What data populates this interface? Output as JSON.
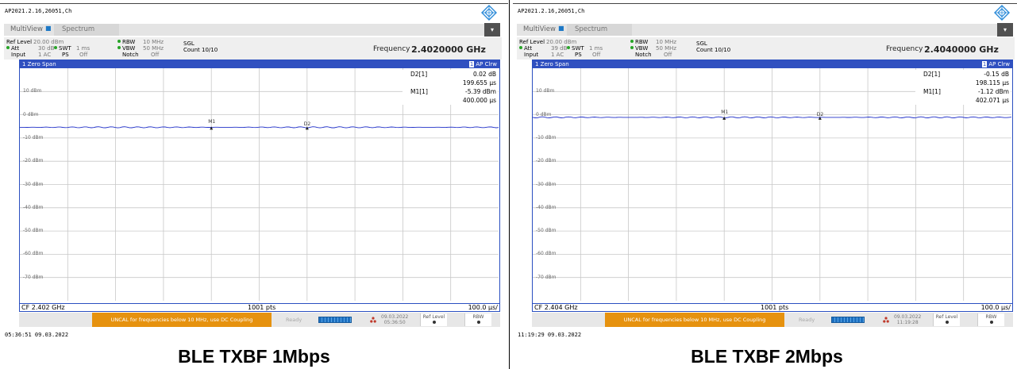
{
  "panels": [
    {
      "filename": "AP2021.2.16,26051,Ch",
      "tabs": {
        "multiview": "MultiView",
        "spectrum": "Spectrum"
      },
      "params": {
        "ref_level_label": "Ref Level",
        "ref_level_value": "20.00 dBm",
        "att_label": "Att",
        "att_value": "30 dB",
        "swt_label": "SWT",
        "swt_value": "1 ms",
        "input_label": "Input",
        "input_value": "1 AC",
        "ps_label": "PS",
        "ps_value": "Off",
        "rbw_label": "RBW",
        "rbw_value": "10 MHz",
        "vbw_label": "VBW",
        "vbw_value": "50 MHz",
        "notch_label": "Notch",
        "notch_value": "Off",
        "sgl": "SGL",
        "count": "Count 10/10",
        "frequency_label": "Frequency",
        "frequency_value": "2.4020000 GHz"
      },
      "plot": {
        "title": "1 Zero Span",
        "trace_num": "1",
        "trace_mode": "AP Clrw",
        "y_labels": [
          "10 dBm",
          "0 dBm",
          "-10 dBm",
          "-20 dBm",
          "-30 dBm",
          "-40 dBm",
          "-50 dBm",
          "-60 dBm",
          "-70 dBm"
        ],
        "markers": [
          {
            "name": "D2[1]",
            "value1": "0.02 dB",
            "value2": "199.655 µs"
          },
          {
            "name": "M1[1]",
            "value1": "-5.39 dBm",
            "value2": "400.000 µs"
          }
        ],
        "marker_labels": {
          "m1": "M1",
          "d2": "D2"
        },
        "trace_level_dbm": -5.39,
        "footer_cf": "CF 2.402 GHz",
        "footer_pts": "1001 pts",
        "footer_div": "100.0 µs/"
      },
      "status": {
        "uncal": "UNCAL for frequencies below 10 MHz, use DC Coupling",
        "ready": "Ready",
        "date": "09.03.2022",
        "time": "05:36:50",
        "ref_level": "Ref Level",
        "rbw": "RBW"
      },
      "timestamp": "05:36:51  09.03.2022",
      "caption": "BLE TXBF 1Mbps"
    },
    {
      "filename": "AP2021.2.16,26051,Ch",
      "tabs": {
        "multiview": "MultiView",
        "spectrum": "Spectrum"
      },
      "params": {
        "ref_level_label": "Ref Level",
        "ref_level_value": "20.00 dBm",
        "att_label": "Att",
        "att_value": "39 dB",
        "swt_label": "SWT",
        "swt_value": "1 ms",
        "input_label": "Input",
        "input_value": "1 AC",
        "ps_label": "PS",
        "ps_value": "Off",
        "rbw_label": "RBW",
        "rbw_value": "10 MHz",
        "vbw_label": "VBW",
        "vbw_value": "50 MHz",
        "notch_label": "Notch",
        "notch_value": "Off",
        "sgl": "SGL",
        "count": "Count 10/10",
        "frequency_label": "Frequency",
        "frequency_value": "2.4040000 GHz"
      },
      "plot": {
        "title": "1 Zero Span",
        "trace_num": "1",
        "trace_mode": "AP Clrw",
        "y_labels": [
          "10 dBm",
          "0 dBm",
          "-10 dBm",
          "-20 dBm",
          "-30 dBm",
          "-40 dBm",
          "-50 dBm",
          "-60 dBm",
          "-70 dBm"
        ],
        "markers": [
          {
            "name": "D2[1]",
            "value1": "-0.15 dB",
            "value2": "198.115 µs"
          },
          {
            "name": "M1[1]",
            "value1": "-1.12 dBm",
            "value2": "402.071 µs"
          }
        ],
        "marker_labels": {
          "m1": "M1",
          "d2": "D2"
        },
        "trace_level_dbm": -1.12,
        "footer_cf": "CF 2.404 GHz",
        "footer_pts": "1001 pts",
        "footer_div": "100.0 µs/"
      },
      "status": {
        "uncal": "UNCAL for frequencies below 10 MHz, use DC Coupling",
        "ready": "Ready",
        "date": "09.03.2022",
        "time": "11:19:28",
        "ref_level": "Ref Level",
        "rbw": "RBW"
      },
      "timestamp": "11:19:29  09.03.2022",
      "caption": "BLE TXBF 2Mbps"
    }
  ],
  "colors": {
    "trace": "#2030c8",
    "frame": "#2a4fc0",
    "status_warning": "#e6920f",
    "dot_active": "#27a427"
  }
}
